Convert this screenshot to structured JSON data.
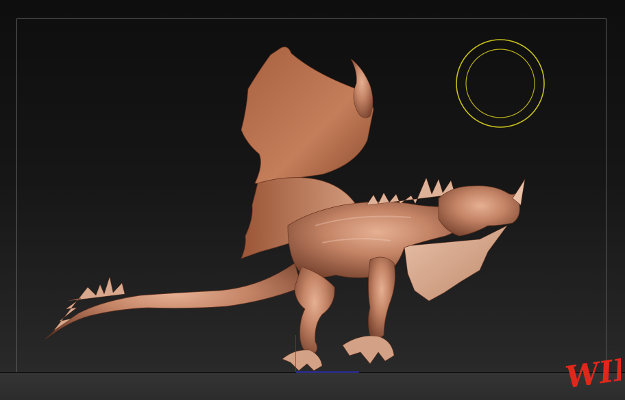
{
  "viewport": {
    "background_top": "#0e0e0e",
    "background_bottom": "#2d2d2d",
    "frame_color": "#5a5a5a"
  },
  "brush_cursor": {
    "icon": "brush-circle-icon",
    "color": "#c9c21a"
  },
  "model": {
    "subject": "dragon-sculpt",
    "material_color": "#c08060"
  },
  "watermark": {
    "text": "WIP",
    "color": "#e0281a"
  }
}
